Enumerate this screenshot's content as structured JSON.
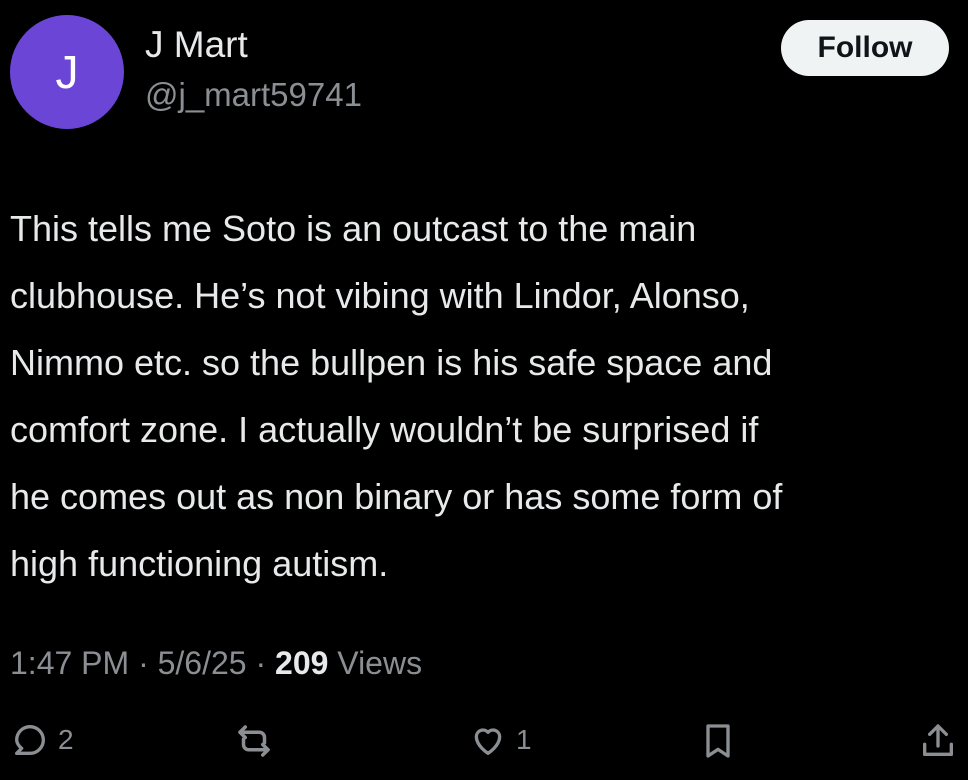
{
  "user": {
    "avatar_letter": "J",
    "avatar_color": "#6b46d6",
    "display_name": "J Mart",
    "handle": "@j_mart59741"
  },
  "follow_label": "Follow",
  "tweet": {
    "lines": [
      "This tells me Soto is an outcast to the main",
      "clubhouse. He’s not vibing with Lindor, Alonso,",
      "Nimmo etc. so the bullpen is his safe space and",
      "comfort zone. I actually wouldn’t be surprised if",
      "he comes out as non binary or has some form of",
      "high functioning autism."
    ]
  },
  "meta": {
    "time": "1:47 PM",
    "sep1": " · ",
    "date": "5/6/25",
    "sep2": " · ",
    "views_count": "209",
    "views_label": " Views"
  },
  "actions": {
    "reply_icon": "reply-icon",
    "reply_count": "2",
    "retweet_icon": "retweet-icon",
    "like_icon": "heart-icon",
    "like_count": "1",
    "bookmark_icon": "bookmark-icon",
    "share_icon": "share-icon"
  }
}
